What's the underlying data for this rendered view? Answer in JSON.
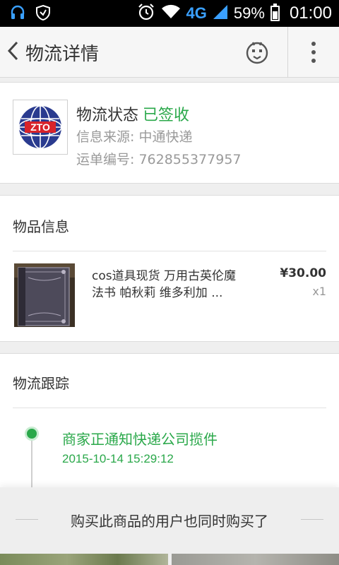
{
  "statusbar": {
    "network": "4G",
    "battery": "59%",
    "time": "01:00"
  },
  "titlebar": {
    "title": "物流详情"
  },
  "logistics": {
    "status_label": "物流状态",
    "status_value": "已签收",
    "source": "信息来源: 中通快递",
    "waybill": "运单编号: 762855377957",
    "logo_text": "ZTO"
  },
  "goods": {
    "section_title": "物品信息",
    "name": "cos道具现货 万用古英伦魔法书 帕秋莉 维多利加 ...",
    "price": "¥30.00",
    "quantity": "x1"
  },
  "tracking": {
    "section_title": "物流跟踪",
    "events": [
      {
        "text": "商家正通知快递公司揽件",
        "time": "2015-10-14 15:29:12"
      }
    ]
  },
  "recommend": {
    "title": "购买此商品的用户也同时购买了"
  },
  "colors": {
    "accent_green": "#2aa84a",
    "network_blue": "#3aa0ff"
  }
}
